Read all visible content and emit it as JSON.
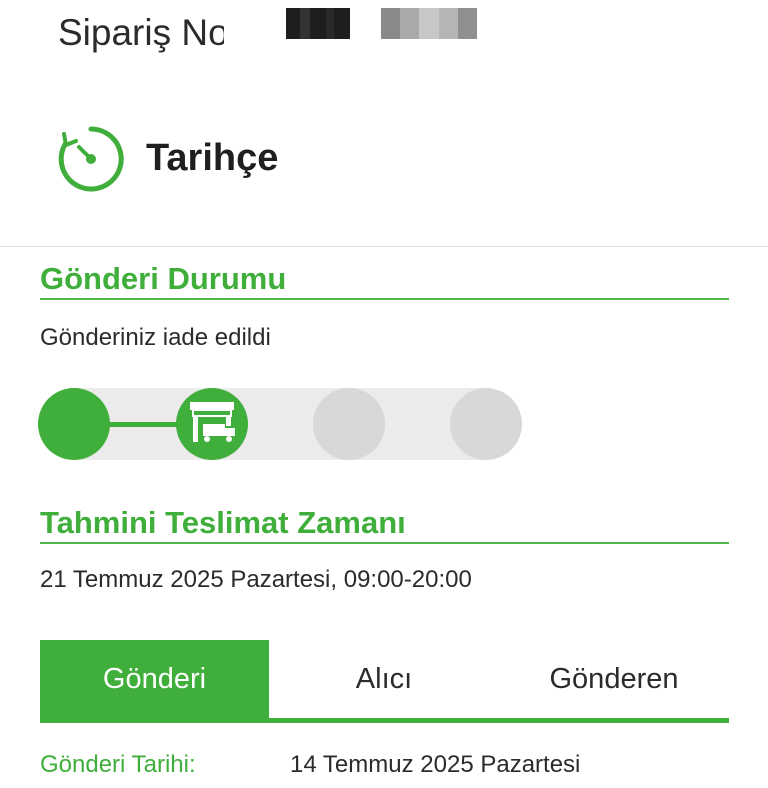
{
  "order": {
    "label": "Sipariş No"
  },
  "history": {
    "title": "Tarihçe",
    "icon": "clock-history-icon"
  },
  "shipment_status": {
    "heading": "Gönderi Durumu",
    "text": "Gönderiniz iade edildi",
    "progress": {
      "completed_steps": 2,
      "total_steps": 4,
      "current_step_icon": "store-truck-icon"
    }
  },
  "estimated_delivery": {
    "heading": "Tahmini Teslimat Zamanı",
    "text": "21 Temmuz 2025 Pazartesi, 09:00-20:00"
  },
  "tabs": [
    {
      "label": "Gönderi",
      "active": true
    },
    {
      "label": "Alıcı",
      "active": false
    },
    {
      "label": "Gönderen",
      "active": false
    }
  ],
  "details": {
    "date_label": "Gönderi Tarihi:",
    "date_value": "14 Temmuz 2025 Pazartesi"
  },
  "colors": {
    "accent": "#3fae3a",
    "inactive_step": "#d8d8d8",
    "track_bg": "#ebebeb"
  }
}
